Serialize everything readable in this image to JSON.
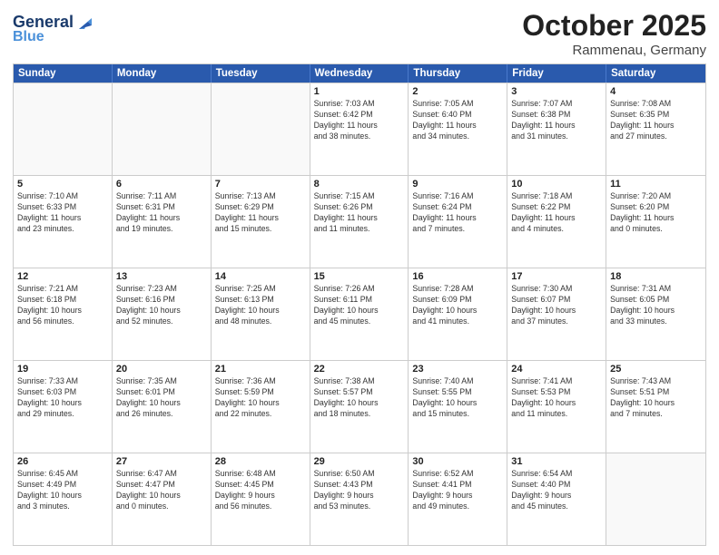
{
  "logo": {
    "line1": "General",
    "line2": "Blue"
  },
  "title": "October 2025",
  "subtitle": "Rammenau, Germany",
  "headers": [
    "Sunday",
    "Monday",
    "Tuesday",
    "Wednesday",
    "Thursday",
    "Friday",
    "Saturday"
  ],
  "weeks": [
    [
      {
        "day": "",
        "info": ""
      },
      {
        "day": "",
        "info": ""
      },
      {
        "day": "",
        "info": ""
      },
      {
        "day": "1",
        "info": "Sunrise: 7:03 AM\nSunset: 6:42 PM\nDaylight: 11 hours\nand 38 minutes."
      },
      {
        "day": "2",
        "info": "Sunrise: 7:05 AM\nSunset: 6:40 PM\nDaylight: 11 hours\nand 34 minutes."
      },
      {
        "day": "3",
        "info": "Sunrise: 7:07 AM\nSunset: 6:38 PM\nDaylight: 11 hours\nand 31 minutes."
      },
      {
        "day": "4",
        "info": "Sunrise: 7:08 AM\nSunset: 6:35 PM\nDaylight: 11 hours\nand 27 minutes."
      }
    ],
    [
      {
        "day": "5",
        "info": "Sunrise: 7:10 AM\nSunset: 6:33 PM\nDaylight: 11 hours\nand 23 minutes."
      },
      {
        "day": "6",
        "info": "Sunrise: 7:11 AM\nSunset: 6:31 PM\nDaylight: 11 hours\nand 19 minutes."
      },
      {
        "day": "7",
        "info": "Sunrise: 7:13 AM\nSunset: 6:29 PM\nDaylight: 11 hours\nand 15 minutes."
      },
      {
        "day": "8",
        "info": "Sunrise: 7:15 AM\nSunset: 6:26 PM\nDaylight: 11 hours\nand 11 minutes."
      },
      {
        "day": "9",
        "info": "Sunrise: 7:16 AM\nSunset: 6:24 PM\nDaylight: 11 hours\nand 7 minutes."
      },
      {
        "day": "10",
        "info": "Sunrise: 7:18 AM\nSunset: 6:22 PM\nDaylight: 11 hours\nand 4 minutes."
      },
      {
        "day": "11",
        "info": "Sunrise: 7:20 AM\nSunset: 6:20 PM\nDaylight: 11 hours\nand 0 minutes."
      }
    ],
    [
      {
        "day": "12",
        "info": "Sunrise: 7:21 AM\nSunset: 6:18 PM\nDaylight: 10 hours\nand 56 minutes."
      },
      {
        "day": "13",
        "info": "Sunrise: 7:23 AM\nSunset: 6:16 PM\nDaylight: 10 hours\nand 52 minutes."
      },
      {
        "day": "14",
        "info": "Sunrise: 7:25 AM\nSunset: 6:13 PM\nDaylight: 10 hours\nand 48 minutes."
      },
      {
        "day": "15",
        "info": "Sunrise: 7:26 AM\nSunset: 6:11 PM\nDaylight: 10 hours\nand 45 minutes."
      },
      {
        "day": "16",
        "info": "Sunrise: 7:28 AM\nSunset: 6:09 PM\nDaylight: 10 hours\nand 41 minutes."
      },
      {
        "day": "17",
        "info": "Sunrise: 7:30 AM\nSunset: 6:07 PM\nDaylight: 10 hours\nand 37 minutes."
      },
      {
        "day": "18",
        "info": "Sunrise: 7:31 AM\nSunset: 6:05 PM\nDaylight: 10 hours\nand 33 minutes."
      }
    ],
    [
      {
        "day": "19",
        "info": "Sunrise: 7:33 AM\nSunset: 6:03 PM\nDaylight: 10 hours\nand 29 minutes."
      },
      {
        "day": "20",
        "info": "Sunrise: 7:35 AM\nSunset: 6:01 PM\nDaylight: 10 hours\nand 26 minutes."
      },
      {
        "day": "21",
        "info": "Sunrise: 7:36 AM\nSunset: 5:59 PM\nDaylight: 10 hours\nand 22 minutes."
      },
      {
        "day": "22",
        "info": "Sunrise: 7:38 AM\nSunset: 5:57 PM\nDaylight: 10 hours\nand 18 minutes."
      },
      {
        "day": "23",
        "info": "Sunrise: 7:40 AM\nSunset: 5:55 PM\nDaylight: 10 hours\nand 15 minutes."
      },
      {
        "day": "24",
        "info": "Sunrise: 7:41 AM\nSunset: 5:53 PM\nDaylight: 10 hours\nand 11 minutes."
      },
      {
        "day": "25",
        "info": "Sunrise: 7:43 AM\nSunset: 5:51 PM\nDaylight: 10 hours\nand 7 minutes."
      }
    ],
    [
      {
        "day": "26",
        "info": "Sunrise: 6:45 AM\nSunset: 4:49 PM\nDaylight: 10 hours\nand 3 minutes."
      },
      {
        "day": "27",
        "info": "Sunrise: 6:47 AM\nSunset: 4:47 PM\nDaylight: 10 hours\nand 0 minutes."
      },
      {
        "day": "28",
        "info": "Sunrise: 6:48 AM\nSunset: 4:45 PM\nDaylight: 9 hours\nand 56 minutes."
      },
      {
        "day": "29",
        "info": "Sunrise: 6:50 AM\nSunset: 4:43 PM\nDaylight: 9 hours\nand 53 minutes."
      },
      {
        "day": "30",
        "info": "Sunrise: 6:52 AM\nSunset: 4:41 PM\nDaylight: 9 hours\nand 49 minutes."
      },
      {
        "day": "31",
        "info": "Sunrise: 6:54 AM\nSunset: 4:40 PM\nDaylight: 9 hours\nand 45 minutes."
      },
      {
        "day": "",
        "info": ""
      }
    ]
  ]
}
